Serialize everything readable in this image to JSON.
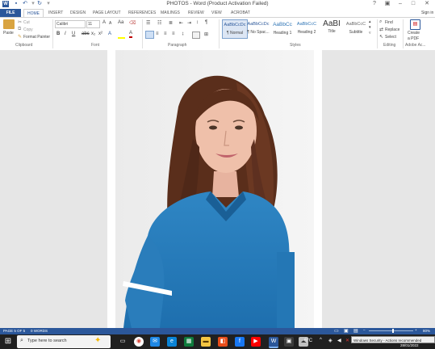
{
  "window": {
    "title": "PHOTOS - Word (Product Activation Failed)",
    "help": "?",
    "sign_in": "Sign in"
  },
  "tabs": [
    "FILE",
    "HOME",
    "INSERT",
    "DESIGN",
    "PAGE LAYOUT",
    "REFERENCES",
    "MAILINGS",
    "REVIEW",
    "VIEW",
    "ACROBAT"
  ],
  "clipboard": {
    "paste": "Paste",
    "cut": "Cut",
    "copy": "Copy",
    "format_painter": "Format Painter",
    "label": "Clipboard"
  },
  "font": {
    "name": "Calibri",
    "size": "11",
    "label": "Font"
  },
  "paragraph": {
    "label": "Paragraph"
  },
  "styles": {
    "label": "Styles",
    "items": [
      {
        "preview": "AaBbCcDc",
        "name": "¶ Normal"
      },
      {
        "preview": "AaBbCcDc",
        "name": "¶ No Spac..."
      },
      {
        "preview": "AaBbCc",
        "name": "Heading 1"
      },
      {
        "preview": "AaBbCcC",
        "name": "Heading 2"
      },
      {
        "preview": "AaBI",
        "name": "Title"
      },
      {
        "preview": "AaBbCcC",
        "name": "Subtitle"
      }
    ]
  },
  "editing": {
    "find": "Find",
    "replace": "Replace",
    "select": "Select",
    "label": "Editing"
  },
  "adobe": {
    "create": "Create",
    "pdf": "a PDF",
    "label": "Adobe Ac..."
  },
  "status": {
    "page": "PAGE 5 OF 5",
    "words": "0 WORDS",
    "zoom": "80%"
  },
  "taskbar": {
    "search_placeholder": "Type here to search",
    "weather": "6°C",
    "toast": "Windows Security - Actions recommended",
    "clock": "28/01/2022"
  },
  "colors": {
    "accent": "#2b579a",
    "taskbar": "#202020"
  }
}
